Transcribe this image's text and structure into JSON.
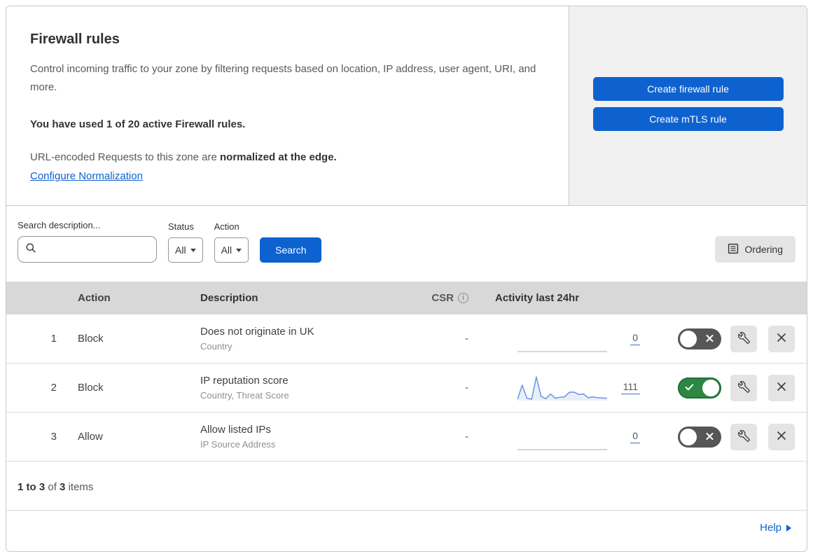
{
  "header": {
    "title": "Firewall rules",
    "description": "Control incoming traffic to your zone by filtering requests based on location, IP address, user agent, URI, and more.",
    "usage": "You have used 1 of 20 active Firewall rules.",
    "norm_prefix": "URL-encoded Requests to this zone are ",
    "norm_bold": "normalized at the edge.",
    "norm_link": "Configure Normalization"
  },
  "actions_panel": {
    "create_firewall": "Create firewall rule",
    "create_mtls": "Create mTLS rule"
  },
  "filters": {
    "search_label": "Search description...",
    "search_value": "",
    "status_label": "Status",
    "status_value": "All",
    "action_label": "Action",
    "action_value": "All",
    "search_button": "Search",
    "ordering_button": "Ordering"
  },
  "table": {
    "columns": {
      "action": "Action",
      "description": "Description",
      "csr": "CSR",
      "activity": "Activity last 24hr"
    },
    "rows": [
      {
        "index": "1",
        "action": "Block",
        "description": "Does not originate in UK",
        "fields": "Country",
        "csr": "-",
        "count": "0",
        "enabled": false,
        "sparkline": []
      },
      {
        "index": "2",
        "action": "Block",
        "description": "IP reputation score",
        "fields": "Country, Threat Score",
        "csr": "-",
        "count": "111",
        "enabled": true,
        "sparkline": [
          5,
          65,
          10,
          6,
          100,
          18,
          8,
          28,
          10,
          14,
          16,
          35,
          36,
          26,
          28,
          12,
          16,
          12,
          11,
          10
        ]
      },
      {
        "index": "3",
        "action": "Allow",
        "description": "Allow listed IPs",
        "fields": "IP Source Address",
        "csr": "-",
        "count": "0",
        "enabled": false,
        "sparkline": []
      }
    ]
  },
  "chart_data": {
    "type": "area",
    "title": "Activity last 24hr sparkline for rule 2 (111 events)",
    "x_range": "last 24 hours",
    "values": [
      5,
      65,
      10,
      6,
      100,
      18,
      8,
      28,
      10,
      14,
      16,
      35,
      36,
      26,
      28,
      12,
      16,
      12,
      11,
      10
    ],
    "total": 111
  },
  "footer": {
    "range": "1 to 3",
    "of": "of",
    "total": "3",
    "items": "items"
  },
  "help": {
    "label": "Help"
  },
  "colors": {
    "accent_blue": "#0d62d0",
    "toggle_on_green": "#2d8743",
    "toggle_off_gray": "#565656",
    "sparkline_blue": "#6b93e0",
    "sparkline_fill": "rgba(107,147,224,0.15)",
    "flat_line_gray": "#bdbdbd",
    "table_header_bg": "#d8d8d8"
  }
}
